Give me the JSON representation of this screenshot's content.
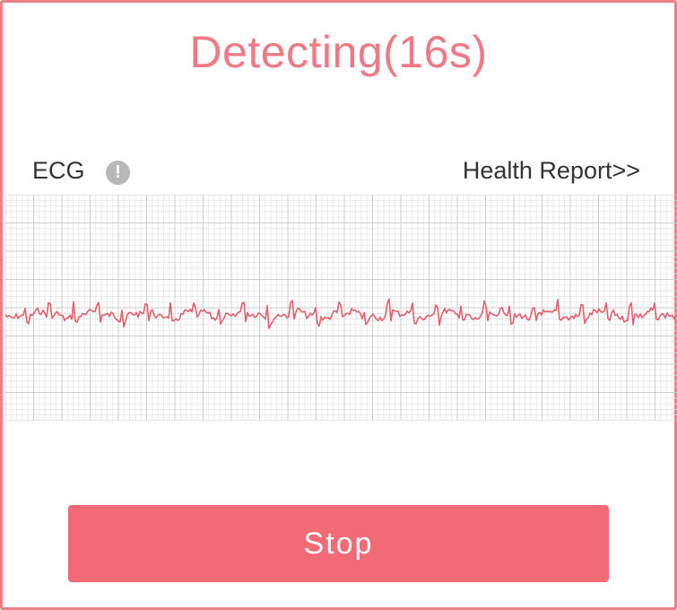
{
  "header": {
    "title": "Detecting(16s)"
  },
  "ecg": {
    "label": "ECG",
    "info_icon": "info-icon",
    "info_glyph": "!",
    "report_link": "Health Report>>"
  },
  "actions": {
    "stop_label": "Stop"
  },
  "colors": {
    "accent": "#f26a76",
    "title": "#ef7a85",
    "waveform": "#e0606d",
    "grid_minor": "#e4e4e4",
    "grid_major": "#cfcfcf"
  }
}
